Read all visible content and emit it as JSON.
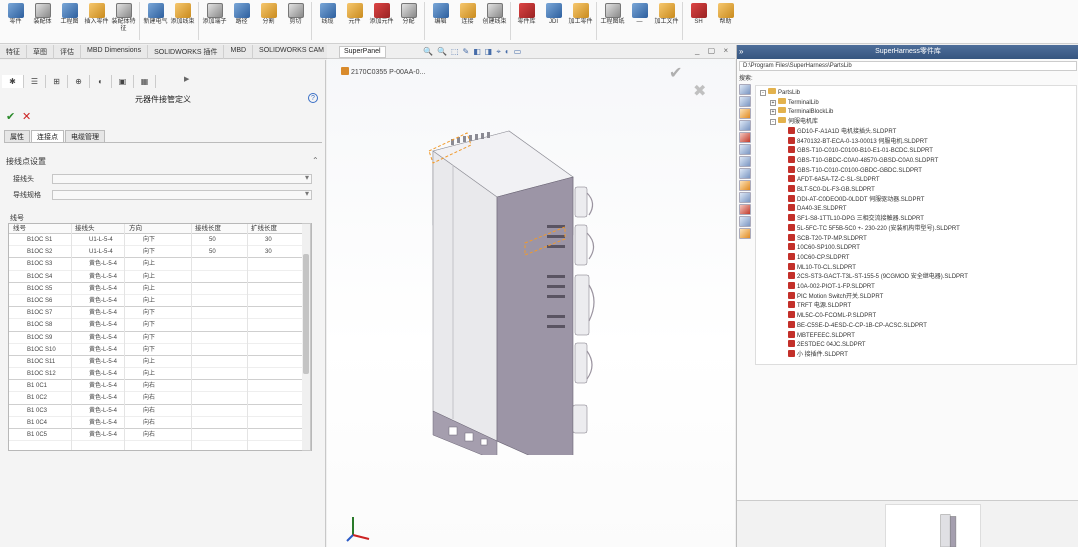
{
  "ribbon": {
    "buttons": [
      {
        "label": "零件",
        "color": "c0"
      },
      {
        "label": "装配体",
        "color": "c1"
      },
      {
        "label": "工程图",
        "color": "c0"
      },
      {
        "label": "插入零件",
        "color": "c2"
      },
      {
        "label": "装配体特征",
        "color": "c1"
      },
      {
        "label": "",
        "color": "c4"
      },
      {
        "label": "新建电气",
        "color": "c0"
      },
      {
        "label": "添加线束",
        "color": "c2"
      },
      {
        "label": "",
        "color": "c4"
      },
      {
        "label": "添加端子",
        "color": "c1"
      },
      {
        "label": "路径",
        "color": "c0"
      },
      {
        "label": "分割",
        "color": "c2"
      },
      {
        "label": "剪切",
        "color": "c1"
      },
      {
        "label": "",
        "color": "c4"
      },
      {
        "label": "线缆",
        "color": "c0"
      },
      {
        "label": "元件",
        "color": "c2"
      },
      {
        "label": "添加元件",
        "color": "c3"
      },
      {
        "label": "分配",
        "color": "c1"
      },
      {
        "label": "",
        "color": "c4"
      },
      {
        "label": "编辑",
        "color": "c0"
      },
      {
        "label": "连接",
        "color": "c2"
      },
      {
        "label": "创建线束",
        "color": "c1"
      },
      {
        "label": "",
        "color": "c4"
      },
      {
        "label": "零件库",
        "color": "c3"
      },
      {
        "label": "JDI",
        "color": "c0"
      },
      {
        "label": "加工零件",
        "color": "c2"
      },
      {
        "label": "",
        "color": "c4"
      },
      {
        "label": "工程图纸",
        "color": "c1"
      },
      {
        "label": "—",
        "color": "c0"
      },
      {
        "label": "加工文件",
        "color": "c2"
      },
      {
        "label": "",
        "color": "c4"
      },
      {
        "label": "SH",
        "color": "c3"
      },
      {
        "label": "帮助",
        "color": "c2"
      }
    ]
  },
  "cm_tabs": [
    "特征",
    "草图",
    "评估",
    "MBD Dimensions",
    "SOLIDWORKS 插件",
    "MBD",
    "SOLIDWORKS CAM"
  ],
  "left_panel": {
    "title": "元器件接管定义",
    "sub_tabs": [
      "属性",
      "连接点",
      "电缆管理"
    ],
    "section_title": "接线点设置",
    "field1_label": "接线头",
    "field2_label": "导线规格",
    "list_label": "线号",
    "columns": [
      "线号",
      "接线头",
      "方向",
      "接线长度",
      "扩线长度"
    ],
    "rows": [
      [
        "B1OC S1",
        "U1-L-5-4",
        "向下",
        "50",
        "30"
      ],
      [
        "B1OC S2",
        "U1-L-5-4",
        "向下",
        "50",
        "30"
      ],
      [
        "B1OC S3",
        "黄色-L-5-4",
        "向上",
        "",
        ""
      ],
      [
        "B1OC S4",
        "黄色-L-5-4",
        "向上",
        "",
        ""
      ],
      [
        "B1OC S5",
        "黄色-L-5-4",
        "向上",
        "",
        ""
      ],
      [
        "B1OC S6",
        "黄色-L-5-4",
        "向上",
        "",
        ""
      ],
      [
        "B1OC S7",
        "黄色-L-5-4",
        "向下",
        "",
        ""
      ],
      [
        "B1OC S8",
        "黄色-L-5-4",
        "向下",
        "",
        ""
      ],
      [
        "B1OC S9",
        "黄色-L-5-4",
        "向下",
        "",
        ""
      ],
      [
        "B1OC S10",
        "黄色-L-5-4",
        "向下",
        "",
        ""
      ],
      [
        "B1OC S11",
        "黄色-L-5-4",
        "向上",
        "",
        ""
      ],
      [
        "B1OC S12",
        "黄色-L-5-4",
        "向上",
        "",
        ""
      ],
      [
        "B1 0C1",
        "黄色-L-5-4",
        "向右",
        "",
        ""
      ],
      [
        "B1 0C2",
        "黄色-L-5-4",
        "向右",
        "",
        ""
      ],
      [
        "B1 0C3",
        "黄色-L-5-4",
        "向右",
        "",
        ""
      ],
      [
        "B1 0C4",
        "黄色-L-5-4",
        "向右",
        "",
        ""
      ],
      [
        "B1 0C5",
        "黄色-L-5-4",
        "向右",
        "",
        ""
      ]
    ]
  },
  "viewport": {
    "tab": "SuperPanel",
    "breadcrumb": "2170C0355 P-00AA-0...",
    "tools": [
      "🔍",
      "🔍",
      "⬚",
      "✎",
      "◧",
      "◨",
      "⌖",
      "◐",
      "▭"
    ],
    "controls": "_ ▢ ×"
  },
  "right_panel": {
    "title": "SuperHarness零件库",
    "path": "D:\\Program Files\\SuperHarness\\PartsLib",
    "search_label": "搜索:",
    "tree": [
      {
        "indent": 0,
        "type": "folder",
        "label": "PartsLib",
        "pm": "-"
      },
      {
        "indent": 1,
        "type": "folder",
        "label": "TerminalLib",
        "pm": "+"
      },
      {
        "indent": 1,
        "type": "folder",
        "label": "TerminalBlockLib",
        "pm": "+"
      },
      {
        "indent": 1,
        "type": "folder",
        "label": "伺服电机库",
        "pm": "-"
      },
      {
        "indent": 2,
        "type": "part",
        "label": "GD10-F-A1A1D 电机接插头.SLDPRT"
      },
      {
        "indent": 2,
        "type": "part",
        "label": "8470132-BT-ECA-0-13-00013 伺服电机.SLDPRT"
      },
      {
        "indent": 2,
        "type": "part",
        "label": "GBS-T10-C010-C0100-B10-E1-01-BCDC.SLDPRT"
      },
      {
        "indent": 2,
        "type": "part",
        "label": "GBS-T10-GBDC-C0A0-48570-GBSD-C0A0.SLDPRT"
      },
      {
        "indent": 2,
        "type": "part",
        "label": "GBS-T10-C010-C0100-GBDC-GBDC.SLDPRT"
      },
      {
        "indent": 2,
        "type": "part",
        "label": "AFDT-6A5A-TZ-C-SL-SLDPRT"
      },
      {
        "indent": 2,
        "type": "part",
        "label": "BLT-5C0-DL-F3-GB.SLDPRT"
      },
      {
        "indent": 2,
        "type": "part",
        "label": "DDI-AT-C0DEO0D-0LDDT 伺服驱动器.SLDPRT"
      },
      {
        "indent": 2,
        "type": "part",
        "label": "DA40-3E.SLDPRT"
      },
      {
        "indent": 2,
        "type": "part",
        "label": "SF1-S8-1TTL10-DPG 三相交流接触器.SLDPRT"
      },
      {
        "indent": 2,
        "type": "part",
        "label": "5L-5FC-TC 5F5B-5C0 +- 230-220 (安装机构带型号).SLDPRT"
      },
      {
        "indent": 2,
        "type": "part",
        "label": "SCB-T20-TP-MP.SLDPRT"
      },
      {
        "indent": 2,
        "type": "part",
        "label": "10C60-SP100.SLDPRT"
      },
      {
        "indent": 2,
        "type": "part",
        "label": "10C60-CP.SLDPRT"
      },
      {
        "indent": 2,
        "type": "part",
        "label": "ML10-T0-CL.SLDPRT"
      },
      {
        "indent": 2,
        "type": "part",
        "label": "2CS-ST3-GACT-T3L-ST-155-5 (9CGMOD 安全继电器).SLDPRT"
      },
      {
        "indent": 2,
        "type": "part",
        "label": "10A-002-PIOT-1-FP.SLDPRT"
      },
      {
        "indent": 2,
        "type": "part",
        "label": "PIC Motion Switch开关.SLDPRT"
      },
      {
        "indent": 2,
        "type": "part",
        "label": "TRFT 电源.SLDPRT"
      },
      {
        "indent": 2,
        "type": "part",
        "label": "ML5C-C0-FCOML-P.SLDPRT"
      },
      {
        "indent": 2,
        "type": "part",
        "label": "BE-C5SE-D-4ESD-C-CP-1B-CP-ACSC.SLDPRT"
      },
      {
        "indent": 2,
        "type": "part",
        "label": "MBTEFEEC.SLDPRT"
      },
      {
        "indent": 2,
        "type": "part",
        "label": "2ESTDEC 04JC.SLDPRT"
      },
      {
        "indent": 2,
        "type": "part",
        "label": "小 接插件.SLDPRT"
      }
    ]
  }
}
